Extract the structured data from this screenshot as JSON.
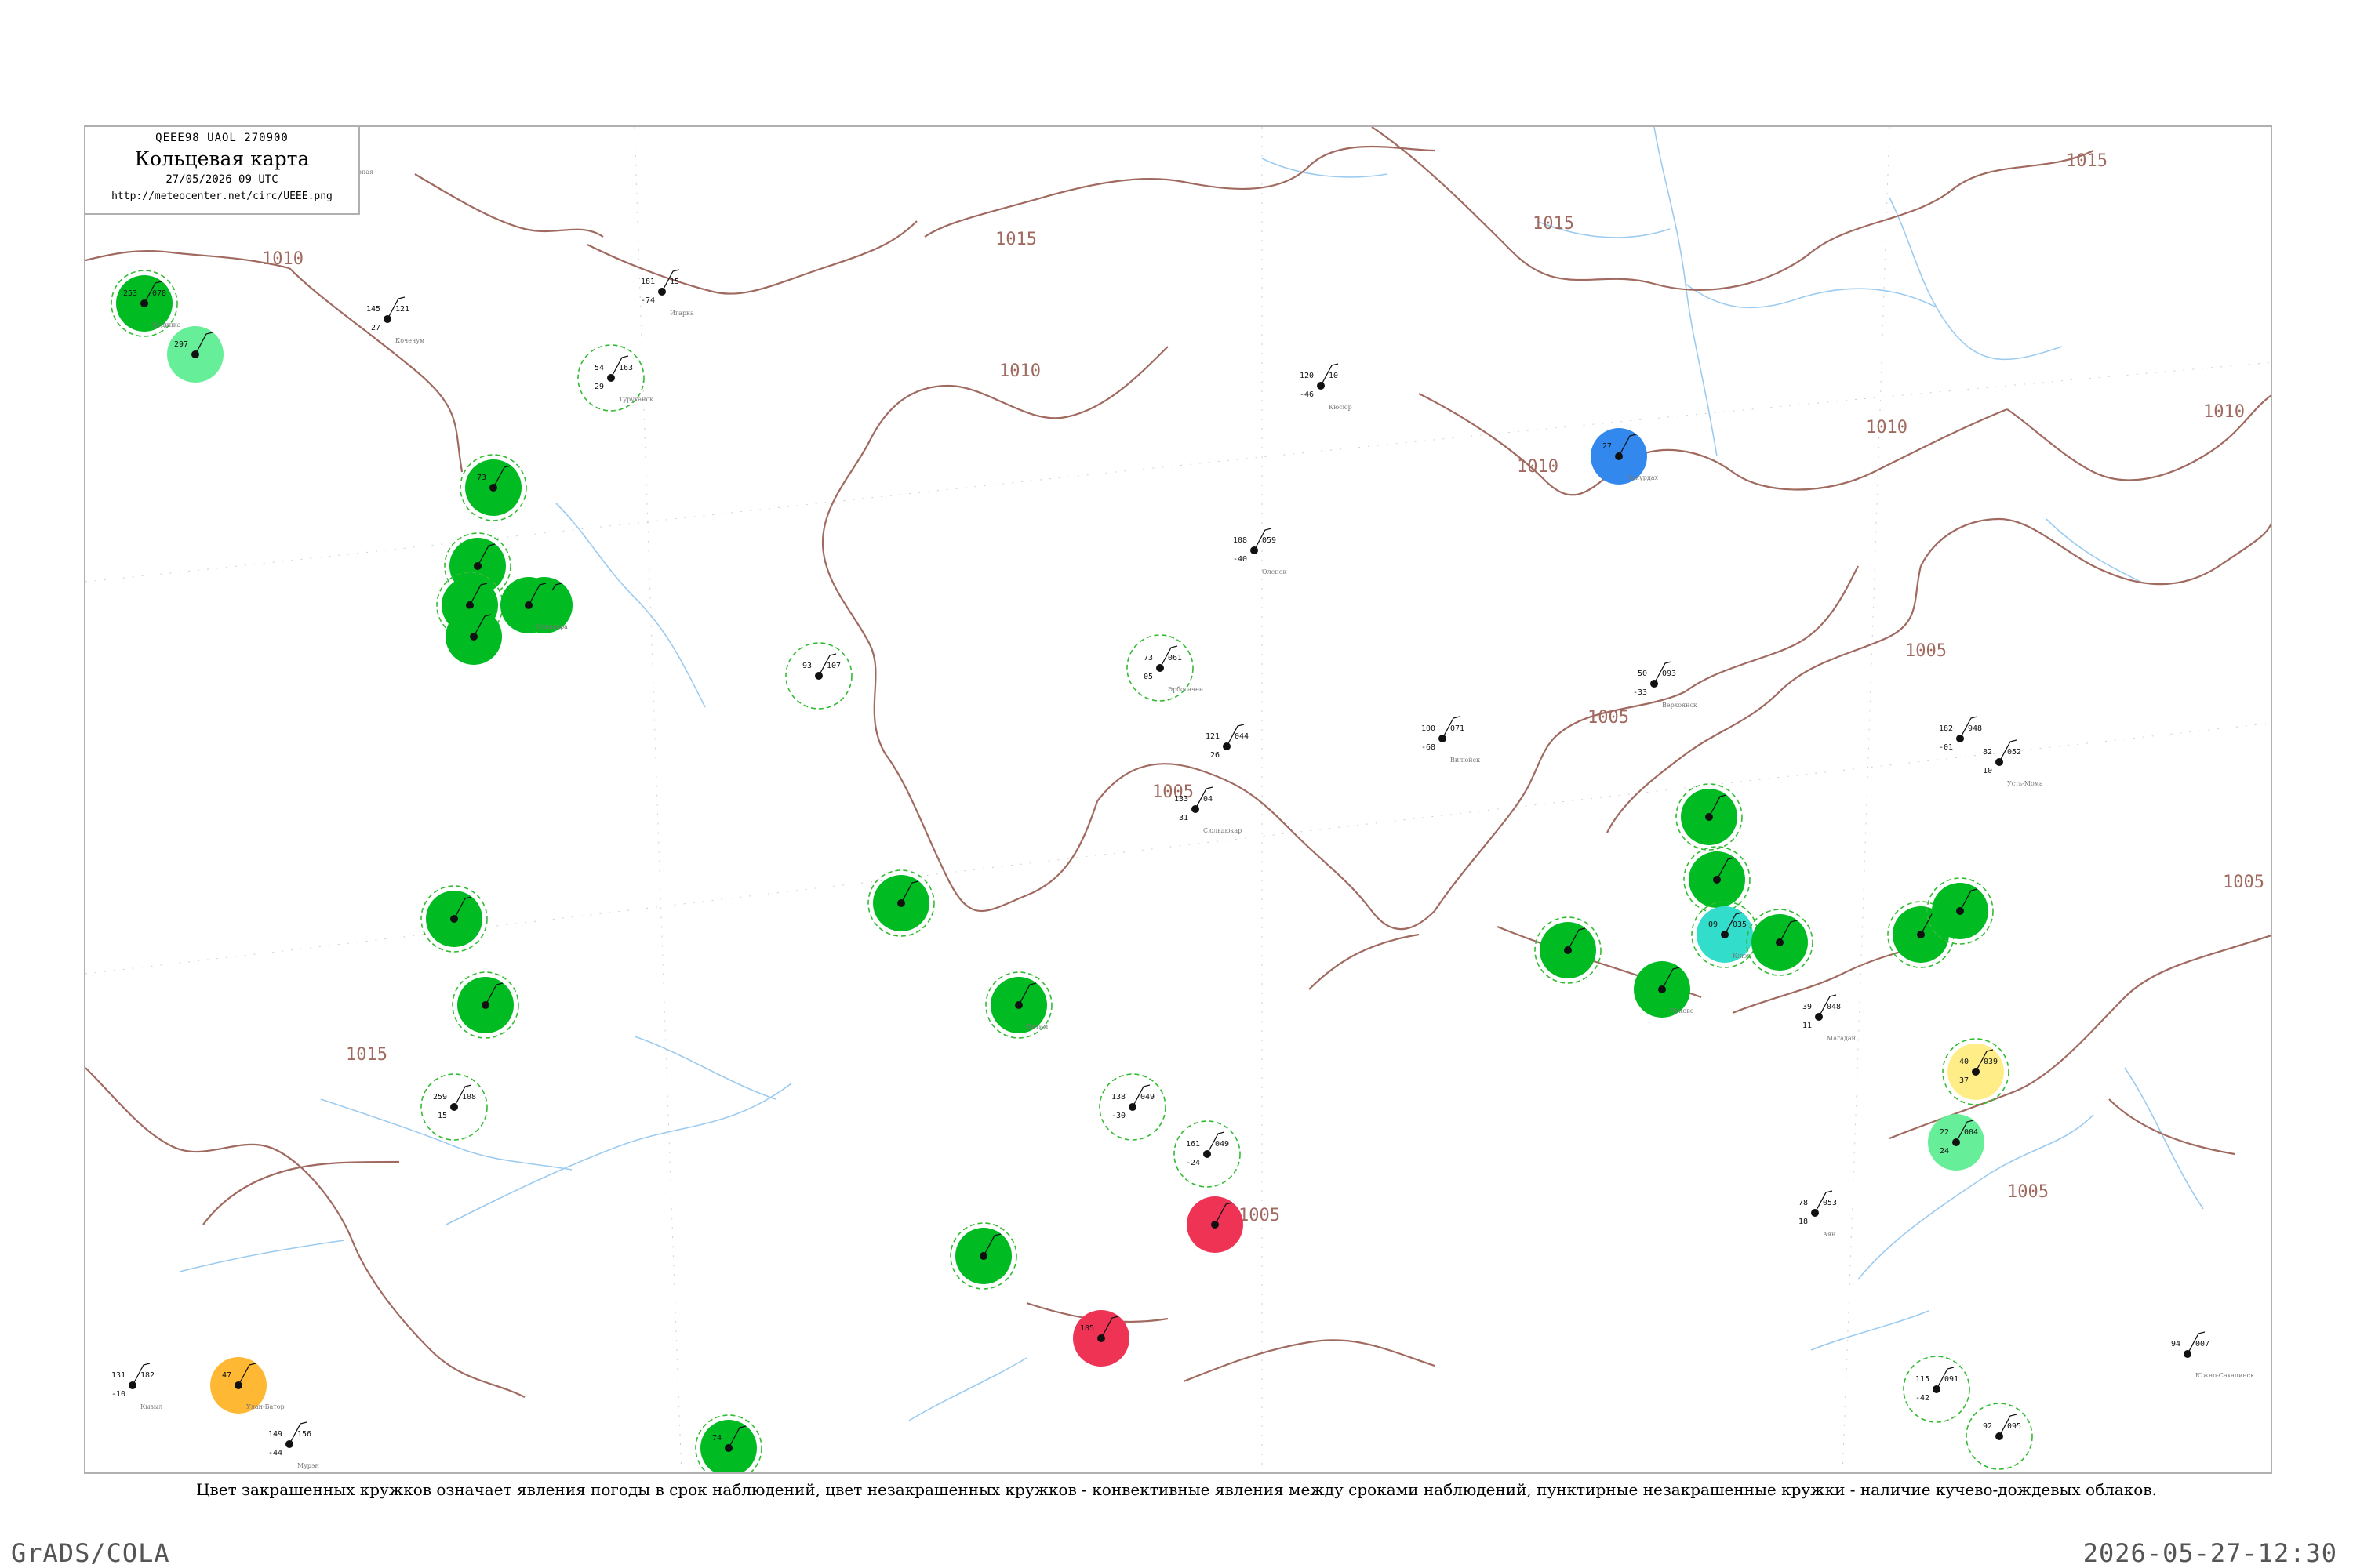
{
  "title": {
    "code": "QEEE98  UAOL  270900",
    "main": "Кольцевая карта",
    "date": "27/05/2026 09 UTC",
    "url": "http://meteocenter.net/circ/UEEE.png"
  },
  "caption": "Цвет закрашенных кружков означает явления погоды в срок наблюдений, цвет незакрашенных кружков - конвективные явления между сроками наблюдений, пунктирные незакрашенные кружки - наличие кучево-дождевых облаков.",
  "footer": {
    "left": "GrADS/COLA",
    "right": "2026-05-27-12:30"
  },
  "colors": {
    "isobar": "#a06a60",
    "river": "#9ccbf0",
    "rain": "#00bb22",
    "cb_ring": "#33bb33",
    "thunder": "#ee3355",
    "snow": "#3388ee",
    "fog": "#ffee88",
    "shower": "#66ee99",
    "haze": "#ffb833",
    "cyan": "#33ddcc"
  },
  "isobar_labels": [
    {
      "id": "1010-a",
      "text": "1010"
    },
    {
      "id": "1015-a",
      "text": "1015"
    },
    {
      "id": "1015-b",
      "text": "1015"
    },
    {
      "id": "1015-c",
      "text": "1015"
    },
    {
      "id": "1010-b",
      "text": "1010"
    },
    {
      "id": "1010-c",
      "text": "1010"
    },
    {
      "id": "1010-d",
      "text": "1010"
    },
    {
      "id": "1010-e",
      "text": "1010"
    },
    {
      "id": "1015-d",
      "text": "1015"
    },
    {
      "id": "1005-a",
      "text": "1005"
    },
    {
      "id": "1005-b",
      "text": "1005"
    },
    {
      "id": "1005-c",
      "text": "1005"
    },
    {
      "id": "1005-d",
      "text": "1005"
    },
    {
      "id": "1005-e",
      "text": "1005"
    },
    {
      "id": "1005-f",
      "text": "1005"
    }
  ],
  "stations": [
    {
      "id": "24125",
      "kind": "none",
      "cb": false,
      "t": "108",
      "p": "059",
      "d": "-40",
      "name": "Оленек"
    },
    {
      "id": "23274",
      "kind": "none",
      "cb": false,
      "t": "181",
      "p": "15",
      "d": "-74",
      "name": "Игарка"
    },
    {
      "id": "23472",
      "kind": "none",
      "cb": true,
      "t": "54",
      "p": "163",
      "d": "29",
      "name": "Туруханск"
    },
    {
      "id": "23552",
      "kind": "rain",
      "cb": true,
      "t": "73",
      "p": "",
      "d": "",
      "name": ""
    },
    {
      "id": "23631",
      "kind": "rain",
      "cb": true,
      "t": "",
      "p": "",
      "d": "",
      "name": ""
    },
    {
      "id": "23724",
      "kind": "rain",
      "cb": true,
      "t": "",
      "p": "",
      "d": "",
      "name": ""
    },
    {
      "id": "23802",
      "kind": "rain",
      "cb": false,
      "t": "",
      "p": "",
      "d": "",
      "name": ""
    },
    {
      "id": "23933",
      "kind": "rain",
      "cb": false,
      "t": "",
      "p": "",
      "d": "",
      "name": ""
    },
    {
      "id": "23788",
      "kind": "rain",
      "cb": false,
      "t": "",
      "p": "",
      "d": "",
      "name": "Ванавара"
    },
    {
      "id": "24507",
      "kind": "none",
      "cb": true,
      "t": "93",
      "p": "107",
      "d": "",
      "name": ""
    },
    {
      "id": "24817",
      "kind": "none",
      "cb": true,
      "t": "73",
      "p": "061",
      "d": "05",
      "name": "Эрбогачен"
    },
    {
      "id": "24641",
      "kind": "none",
      "cb": false,
      "t": "100",
      "p": "071",
      "d": "-68",
      "name": "Вилюйск"
    },
    {
      "id": "24959",
      "kind": "rain",
      "cb": true,
      "t": "",
      "p": "",
      "d": "",
      "name": ""
    },
    {
      "id": "25206",
      "kind": "snow",
      "cb": false,
      "t": "27",
      "p": "",
      "d": "",
      "name": "Чокурдах"
    },
    {
      "id": "21921",
      "kind": "none",
      "cb": false,
      "t": "120",
      "p": "10",
      "d": "-46",
      "name": "Кюсюр"
    },
    {
      "id": "24266",
      "kind": "none",
      "cb": false,
      "t": "50",
      "p": "093",
      "d": "-33",
      "name": "Верхоянск"
    },
    {
      "id": "25400",
      "kind": "none",
      "cb": false,
      "t": "82",
      "p": "052",
      "d": "10",
      "name": "Усть-Мома"
    },
    {
      "id": "24688",
      "kind": "rain",
      "cb": true,
      "t": "",
      "p": "",
      "d": "",
      "name": ""
    },
    {
      "id": "24671",
      "kind": "rain",
      "cb": true,
      "t": "",
      "p": "",
      "d": "",
      "name": ""
    },
    {
      "id": "24691",
      "kind": "cyan",
      "cb": true,
      "t": "09",
      "p": "035",
      "d": "",
      "name": "Ключ"
    },
    {
      "id": "24768",
      "kind": "rain",
      "cb": true,
      "t": "",
      "p": "",
      "d": "",
      "name": ""
    },
    {
      "id": "24944",
      "kind": "rain",
      "cb": false,
      "t": "",
      "p": "",
      "d": "",
      "name": "Леково"
    },
    {
      "id": "25703",
      "kind": "rain",
      "cb": true,
      "t": "",
      "p": "",
      "d": "",
      "name": ""
    },
    {
      "id": "24966",
      "kind": "rain",
      "cb": true,
      "t": "",
      "p": "",
      "d": "",
      "name": ""
    },
    {
      "id": "31026",
      "kind": "fog",
      "cb": true,
      "t": "40",
      "p": "039",
      "d": "37",
      "name": ""
    },
    {
      "id": "31096",
      "kind": "shower",
      "cb": false,
      "t": "22",
      "p": "004",
      "d": "24",
      "name": ""
    },
    {
      "id": "30710",
      "kind": "thunder",
      "cb": false,
      "t": "185",
      "p": "",
      "d": "",
      "name": ""
    },
    {
      "id": "30554",
      "kind": "rain",
      "cb": true,
      "t": "",
      "p": "",
      "d": "",
      "name": ""
    },
    {
      "id": "30230",
      "kind": "rain",
      "cb": true,
      "t": "",
      "p": "",
      "d": "",
      "name": ""
    },
    {
      "id": "30054",
      "kind": "rain",
      "cb": true,
      "t": "",
      "p": "",
      "d": "",
      "name": "Витим"
    },
    {
      "id": "29612",
      "kind": "rain",
      "cb": true,
      "t": "",
      "p": "",
      "d": "",
      "name": ""
    },
    {
      "id": "29726",
      "kind": "rain",
      "cb": true,
      "t": "",
      "p": "",
      "d": "",
      "name": ""
    },
    {
      "id": "30777",
      "kind": "thunder",
      "cb": false,
      "t": "",
      "p": "",
      "d": "",
      "name": ""
    },
    {
      "id": "30830",
      "kind": "rain",
      "cb": true,
      "t": "74",
      "p": "",
      "d": "",
      "name": ""
    },
    {
      "id": "23078",
      "kind": "rain",
      "cb": true,
      "t": "253",
      "p": "078",
      "d": "",
      "name": "Дудинка"
    },
    {
      "id": "24463",
      "kind": "shower",
      "cb": false,
      "t": "297",
      "p": "",
      "d": "",
      "name": ""
    },
    {
      "id": "44292",
      "kind": "haze",
      "cb": false,
      "t": "47",
      "p": "",
      "d": "",
      "name": "Улан-Батор"
    },
    {
      "id": "32150",
      "kind": "none",
      "cb": false,
      "t": "94",
      "p": "007",
      "d": "",
      "name": "Южно-Сахалинск"
    },
    {
      "id": "32061",
      "kind": "none",
      "cb": true,
      "t": "92",
      "p": "095",
      "d": "",
      "name": ""
    },
    {
      "id": "31978",
      "kind": "none",
      "cb": true,
      "t": "115",
      "p": "091",
      "d": "-42",
      "name": ""
    },
    {
      "id": "25551",
      "kind": "none",
      "cb": false,
      "t": "182",
      "p": "948",
      "d": "-01",
      "name": ""
    },
    {
      "id": "31112",
      "kind": "none",
      "cb": false,
      "t": "39",
      "p": "048",
      "d": "11",
      "name": "Магадан"
    },
    {
      "id": "31168",
      "kind": "none",
      "cb": false,
      "t": "78",
      "p": "053",
      "d": "18",
      "name": "Аян"
    },
    {
      "id": "30821",
      "kind": "none",
      "cb": true,
      "t": "161",
      "p": "049",
      "d": "-24",
      "name": ""
    },
    {
      "id": "30758",
      "kind": "none",
      "cb": true,
      "t": "138",
      "p": "049",
      "d": "-30",
      "name": ""
    },
    {
      "id": "24639",
      "kind": "none",
      "cb": false,
      "t": "121",
      "p": "044",
      "d": "26",
      "name": ""
    },
    {
      "id": "24738",
      "kind": "none",
      "cb": false,
      "t": "133",
      "p": "04",
      "d": "31",
      "name": "Сюльдюкар"
    },
    {
      "id": "29849",
      "kind": "none",
      "cb": true,
      "t": "259",
      "p": "108",
      "d": "15",
      "name": ""
    },
    {
      "id": "36096",
      "kind": "none",
      "cb": false,
      "t": "131",
      "p": "182",
      "d": "-10",
      "name": "Кызыл"
    },
    {
      "id": "44231",
      "kind": "none",
      "cb": false,
      "t": "149",
      "p": "156",
      "d": "-44",
      "name": "Мурэн"
    },
    {
      "id": "20476",
      "kind": "none",
      "cb": false,
      "t": "",
      "p": "",
      "d": "",
      "name": "Полярная"
    },
    {
      "id": "23383",
      "kind": "none",
      "cb": false,
      "t": "145",
      "p": "121",
      "d": "27",
      "name": "Кочечум"
    }
  ]
}
